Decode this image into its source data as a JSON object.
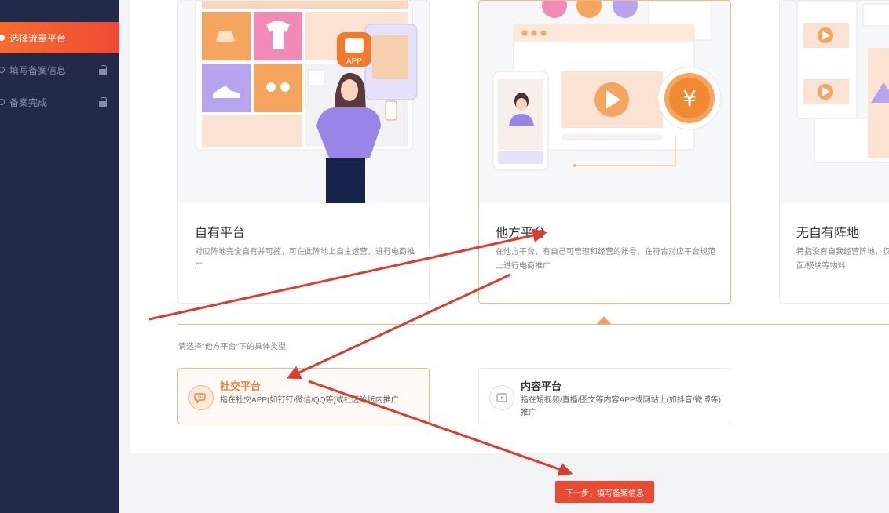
{
  "sidebar": {
    "items": [
      {
        "label": "选择流量平台",
        "active": true,
        "locked": false
      },
      {
        "label": "填写备案信息",
        "active": false,
        "locked": true
      },
      {
        "label": "备案完成",
        "active": false,
        "locked": true
      }
    ]
  },
  "platforms": [
    {
      "title": "自有平台",
      "desc": "对应阵地完全自有并可控，可在此阵地上自主运营，进行电商推广",
      "selected": false,
      "art_text": "APP"
    },
    {
      "title": "他方平台",
      "desc": "在他方平台，有自己可管理和经营的账号，在符合对应平台规范上进行电商推广",
      "selected": true,
      "art_text": "¥"
    },
    {
      "title": "无自有阵地",
      "desc": "特指没有自我经营阵地，仅页面/模块等物料",
      "selected": false
    }
  ],
  "subtype": {
    "hint": "请选择\"他方平台\"下的具体类型",
    "options": [
      {
        "title": "社交平台",
        "desc": "指在社交APP(如钉钉/微信/QQ等)或社区论坛内推广",
        "icon": "chat-icon",
        "selected": true
      },
      {
        "title": "内容平台",
        "desc": "指在短视频/直播/图文等内容APP或网站上(如抖音/微博等)推广",
        "icon": "video-icon",
        "selected": false
      }
    ]
  },
  "next_button": {
    "label": "下一步，填写备案信息"
  },
  "colors": {
    "accent": "#f2812f",
    "button": "#ea4a32",
    "sidebar": "#232949",
    "annotation_arrow": "#e03a2a"
  }
}
